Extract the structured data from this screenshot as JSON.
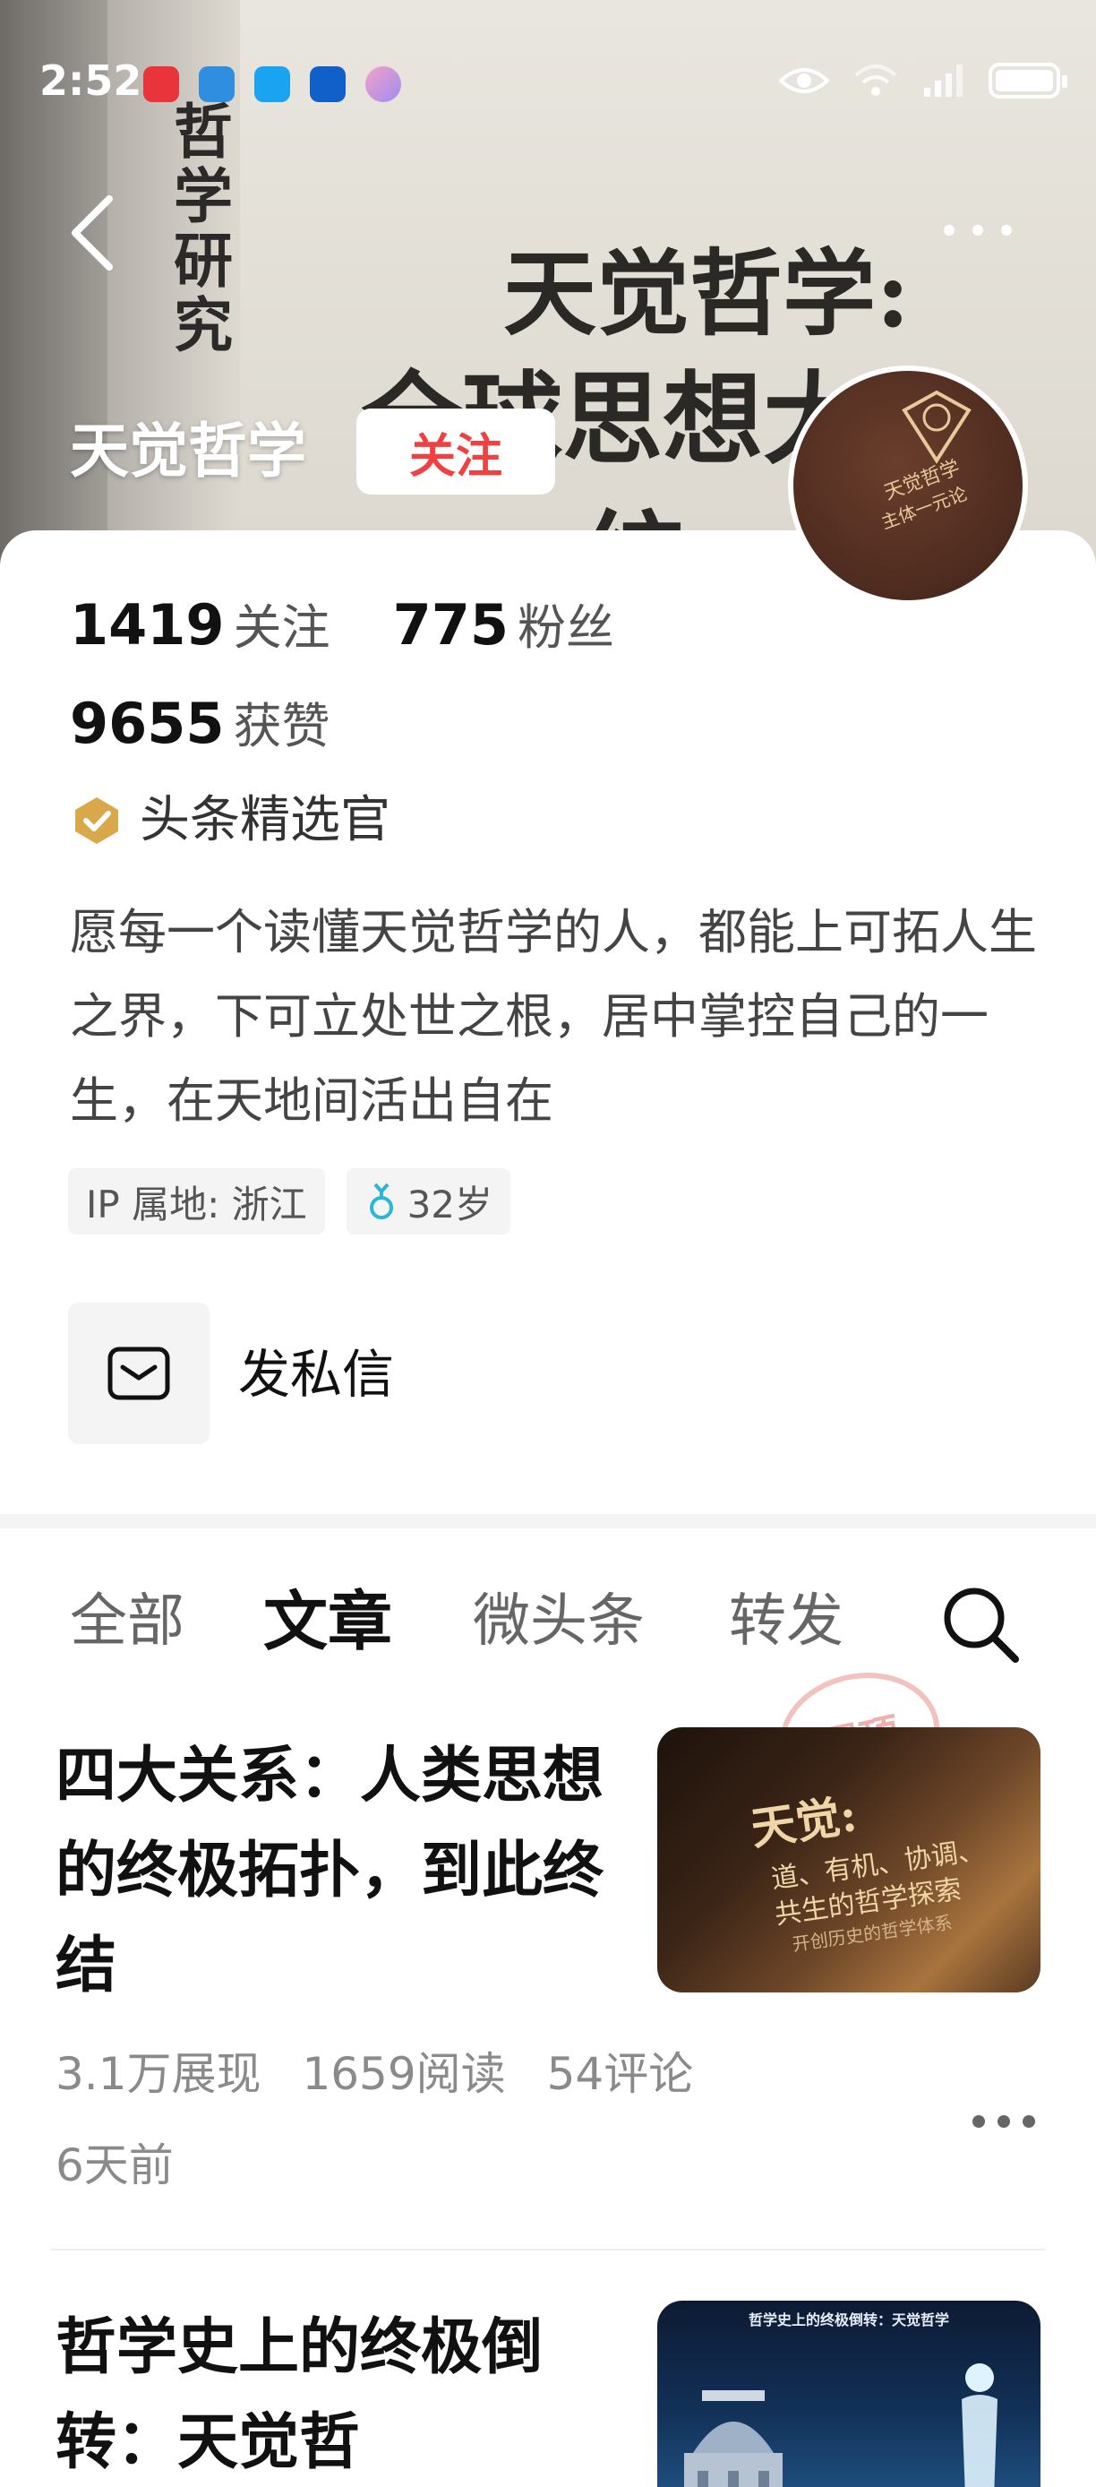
{
  "status_bar": {
    "time": "2:52"
  },
  "banner": {
    "vertical_text": "哲学研究",
    "cover_line1": "天觉哲学:",
    "cover_line2": "全球思想大一",
    "cover_line3": "一统"
  },
  "profile": {
    "name": "天觉哲学",
    "follow_label": "关注",
    "avatar_text_1": "天觉哲学",
    "avatar_text_2": "主体一元论",
    "stats": {
      "following_count": "1419",
      "following_label": "关注",
      "followers_count": "775",
      "followers_label": "粉丝",
      "likes_count": "9655",
      "likes_label": "获赞"
    },
    "verification": "头条精选官",
    "bio": "愿每一个读懂天觉哲学的人，都能上可拓人生之界，下可立处世之根，居中掌控自己的一生，在天地间活出自在",
    "tags": {
      "ip_location": "IP 属地: 浙江",
      "age": "32岁"
    },
    "message_label": "发私信"
  },
  "tabs": [
    {
      "label": "全部",
      "active": false
    },
    {
      "label": "文章",
      "active": true
    },
    {
      "label": "微头条",
      "active": false
    },
    {
      "label": "转发",
      "active": false
    }
  ],
  "articles": [
    {
      "title": "四大关系：人类思想的终极拓扑，到此终结",
      "impressions": "3.1万展现",
      "reads": "1659阅读",
      "comments": "54评论",
      "time": "6天前",
      "stamp": "置顶",
      "thumb_line1": "天觉:",
      "thumb_line2": "道、有机、协调、",
      "thumb_line3": "共生的哲学探索",
      "thumb_line4": "开创历史的哲学体系"
    },
    {
      "title": "哲学史上的终极倒转：天觉哲",
      "thumb_title": "哲学史上的终极倒转：天觉哲学"
    }
  ],
  "colors": {
    "accent_red": "#f04142",
    "verify_gold": "#d9a84a",
    "age_icon": "#2bb6d8"
  },
  "icons": [
    "back-arrow-icon",
    "more-dots-icon",
    "verified-badge-icon",
    "male-icon",
    "message-icon",
    "search-icon"
  ]
}
